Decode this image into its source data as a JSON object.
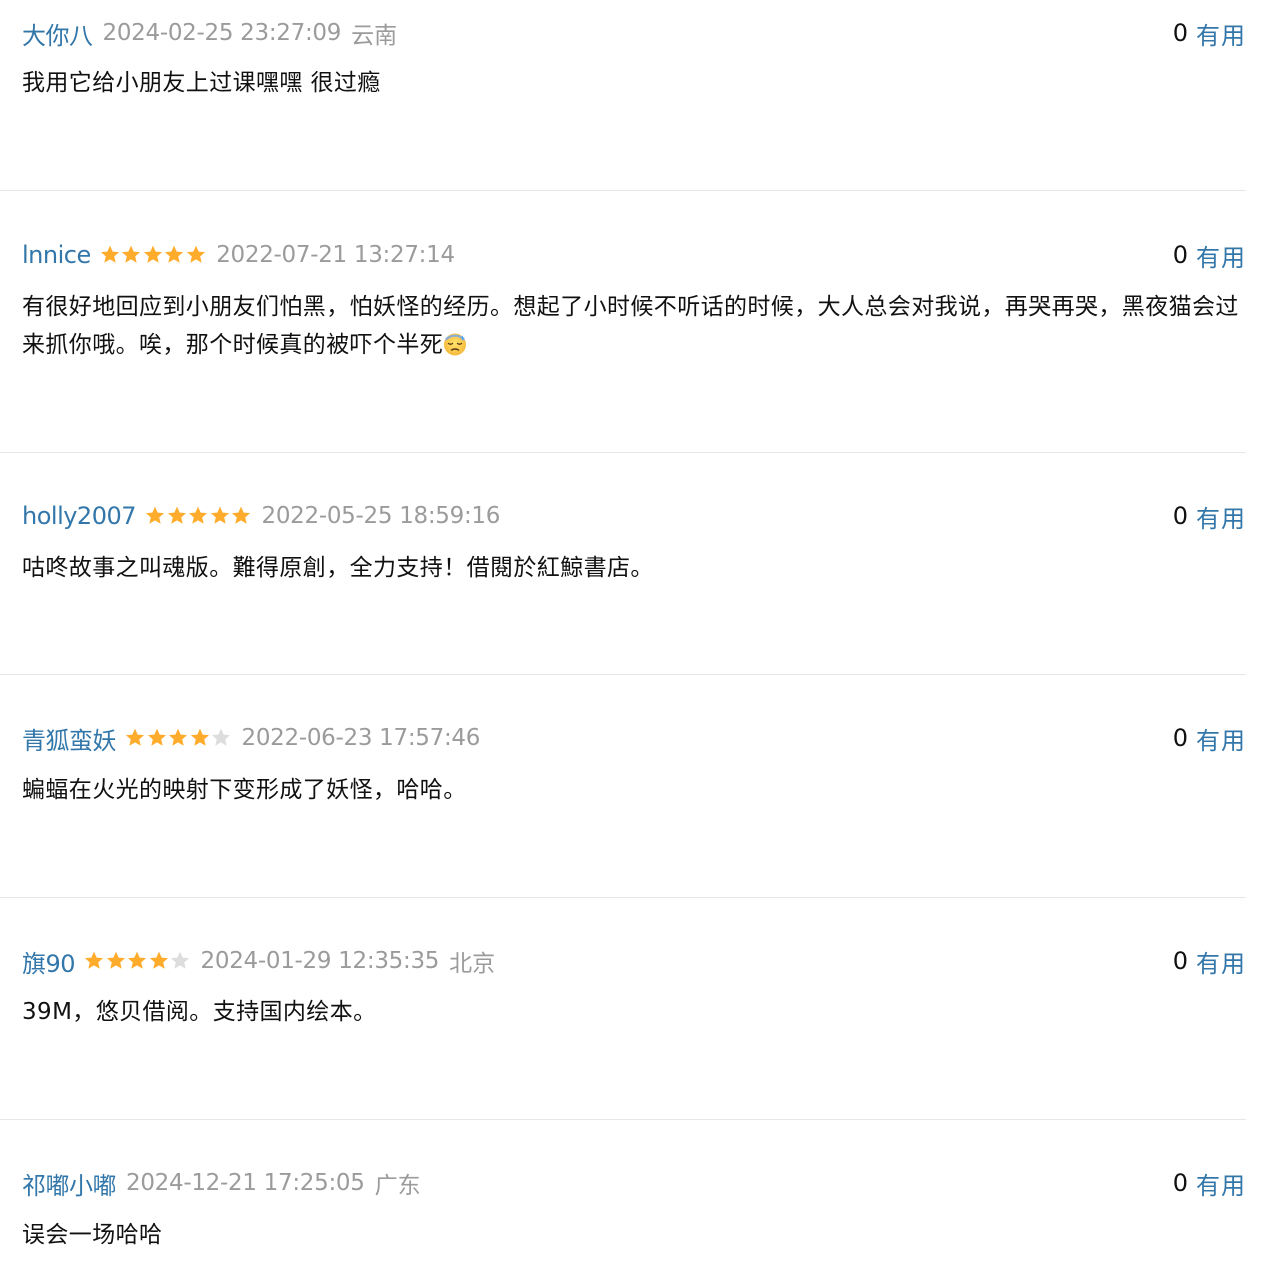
{
  "vote_label": "有用",
  "colors": {
    "link": "#3377aa",
    "star_on": "#ffac2d",
    "star_off": "#dddddd",
    "meta_gray": "#9b9b9b",
    "divider": "#e6e6e6"
  },
  "comments": [
    {
      "author": "大你八",
      "rating": 0,
      "time": "2024-02-25 23:27:09",
      "location": "云南",
      "votes": "0",
      "content": "我用它给小朋友上过课嘿嘿 很过瘾"
    },
    {
      "author": "lnnice",
      "rating": 5,
      "time": "2022-07-21 13:27:14",
      "location": "",
      "votes": "0",
      "content": "有很好地回应到小朋友们怕黑，怕妖怪的经历。想起了小时候不听话的时候，大人总会对我说，再哭再哭，黑夜猫会过来抓你哦。唉，那个时候真的被吓个半死",
      "emoji": "downcast-sweat-face-icon"
    },
    {
      "author": "holly2007",
      "rating": 5,
      "time": "2022-05-25 18:59:16",
      "location": "",
      "votes": "0",
      "content": "咕咚故事之叫魂版。難得原創，全力支持！借閱於紅鯨書店。"
    },
    {
      "author": "青狐蛮妖",
      "rating": 4,
      "time": "2022-06-23 17:57:46",
      "location": "",
      "votes": "0",
      "content": "蝙蝠在火光的映射下变形成了妖怪，哈哈。"
    },
    {
      "author": "旗90",
      "rating": 4,
      "time": "2024-01-29 12:35:35",
      "location": "北京",
      "votes": "0",
      "content": "39M，悠贝借阅。支持国内绘本。"
    },
    {
      "author": "祁嘟小嘟",
      "rating": 0,
      "time": "2024-12-21 17:25:05",
      "location": "广东",
      "votes": "0",
      "content": "误会一场哈哈"
    }
  ]
}
